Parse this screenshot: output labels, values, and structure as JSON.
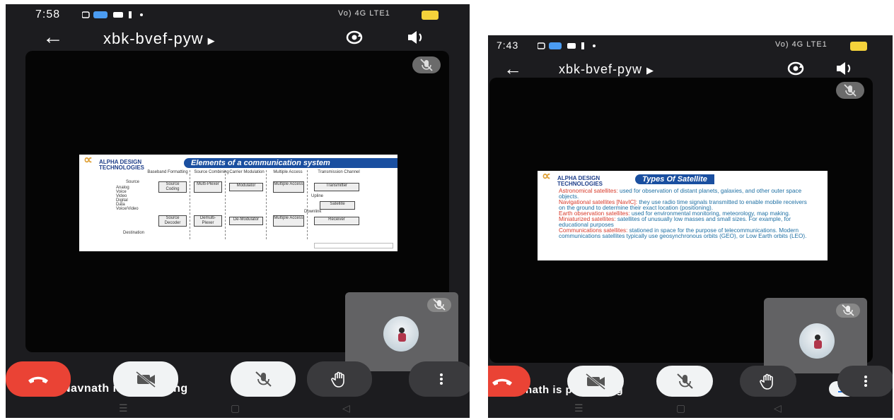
{
  "phone_left": {
    "status_time": "7:58",
    "status_signal": "Vo) 4G LTE1",
    "meeting_code": "xbk-bvef-pyw",
    "presenter_text": "Navnath is presenting",
    "slide": {
      "logo_text": "ALPHA DESIGN TECHNOLOGIES",
      "banner": "Elements of a communication system",
      "columns": [
        "Baseband Formatting",
        "Source Combining",
        "Carrier Modulation",
        "Multiple Access",
        "Transmission Channel"
      ],
      "top_boxes": [
        "Source Coding",
        "Multi-Plexer",
        "Modulator",
        "Multiple Access",
        "Transmitter"
      ],
      "bottom_boxes": [
        "Source Decoder",
        "Demulti-Plexer",
        "De-Modulator",
        "Multiple Access",
        "Receiver"
      ],
      "satellite_box": "Satellite",
      "source_label": "Source",
      "source_types": "Analog\nVoice\nVideo\nDigital\nData\nVoice/Video",
      "destination_label": "Destination",
      "uplink_label": "Upline",
      "downlink_label": "Downlink"
    }
  },
  "phone_right": {
    "status_time": "7:43",
    "status_signal": "Vo) 4G LTE1",
    "meeting_code": "xbk-bvef-pyw",
    "presenter_text": "Navnath is presenting",
    "slide": {
      "logo_text": "ALPHA DESIGN TECHNOLOGIES",
      "banner": "Types Of Satellite",
      "items": [
        {
          "term": "Astronomical satellites:",
          "desc": " used for observation of distant planets, galaxies, and other outer space objects."
        },
        {
          "term": "Navigational satellites [NavIC]:",
          "desc": " they use radio time signals transmitted to enable mobile receivers on the ground to determine their exact location (positioning)."
        },
        {
          "term": "Earth observation satellites:",
          "desc": " used for environmental monitoring, meteorology, map making."
        },
        {
          "term": "Miniaturized satellites:",
          "desc": " satellites of unusually low masses and small sizes. For example, for educational purposes"
        },
        {
          "term": "Communications satellites:",
          "desc": " stationed in space for the purpose of telecommunications. Modern communications satellites typically use geosynchronous orbits (GEO), or Low Earth orbits (LEO)."
        }
      ]
    }
  },
  "icons": {
    "back": "arrow-left-icon",
    "swap": "camera-switch-icon",
    "volume": "speaker-icon",
    "mic_off": "mic-off-icon",
    "video_off": "video-off-icon",
    "hand": "raise-hand-icon",
    "more": "more-vert-icon",
    "end_call": "end-call-icon",
    "minimize": "minimize-icon"
  },
  "colors": {
    "end_call": "#ea4335",
    "background": "#1c1c1f",
    "battery": "#f4d23b",
    "slide_banner": "#1a4fa0",
    "slide_red": "#d83a2a",
    "slide_blue": "#1d6fa3"
  }
}
